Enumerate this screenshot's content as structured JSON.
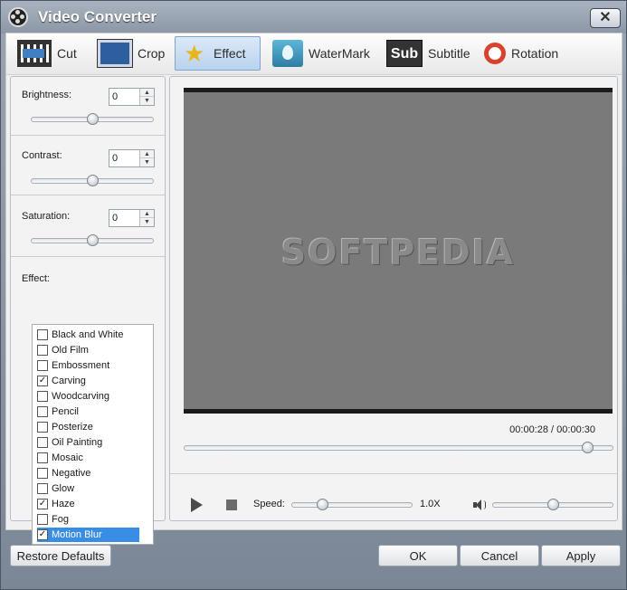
{
  "window": {
    "title": "Video Converter",
    "close_symbol": "✕"
  },
  "toolbar": {
    "tabs": [
      {
        "label": "Cut",
        "icon": "film-scissors-icon"
      },
      {
        "label": "Crop",
        "icon": "crop-icon"
      },
      {
        "label": "Effect",
        "icon": "effect-star-icon",
        "active": true
      },
      {
        "label": "WaterMark",
        "icon": "watermark-icon"
      },
      {
        "label": "Subtitle",
        "icon": "subtitle-icon"
      },
      {
        "label": "Rotation",
        "icon": "rotation-icon"
      }
    ],
    "subtitle_icon_text": "Sub"
  },
  "adjustments": {
    "brightness": {
      "label": "Brightness:",
      "value": "0",
      "level": 0.5
    },
    "contrast": {
      "label": "Contrast:",
      "value": "0",
      "level": 0.5
    },
    "saturation": {
      "label": "Saturation:",
      "value": "0",
      "level": 0.5
    }
  },
  "effects": {
    "label": "Effect:",
    "items": [
      {
        "label": "Black and White",
        "checked": false
      },
      {
        "label": "Old Film",
        "checked": false
      },
      {
        "label": "Embossment",
        "checked": false
      },
      {
        "label": "Carving",
        "checked": true
      },
      {
        "label": "Woodcarving",
        "checked": false
      },
      {
        "label": "Pencil",
        "checked": false
      },
      {
        "label": "Posterize",
        "checked": false
      },
      {
        "label": "Oil Painting",
        "checked": false
      },
      {
        "label": "Mosaic",
        "checked": false
      },
      {
        "label": "Negative",
        "checked": false
      },
      {
        "label": "Glow",
        "checked": false
      },
      {
        "label": "Haze",
        "checked": true
      },
      {
        "label": "Fog",
        "checked": false
      },
      {
        "label": "Motion Blur",
        "checked": true,
        "selected": true
      }
    ]
  },
  "preview": {
    "watermark_text": "SOFTPEDIA",
    "current_time": "00:00:28",
    "time_separator": "/",
    "total_time": "00:00:30",
    "seek_level": 0.94
  },
  "playback": {
    "speed_label": "Speed:",
    "speed_value": "1.0X",
    "speed_level": 0.25,
    "volume_level": 0.5
  },
  "buttons": {
    "restore_defaults": "Restore Defaults",
    "ok": "OK",
    "cancel": "Cancel",
    "apply": "Apply"
  },
  "colors": {
    "accent": "#3a8de5",
    "title_bar": "#8c97a6"
  }
}
